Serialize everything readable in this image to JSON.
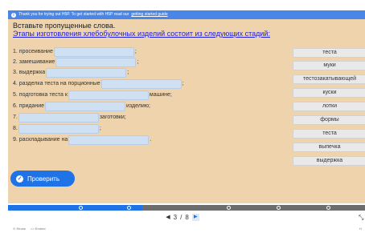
{
  "notice": {
    "text": "Thank you for trying out H5P. To get started with H5P read our",
    "link": "getting started guide"
  },
  "task": {
    "instruction": "Вставьте пропущенные слова.",
    "title": "Этапы изготовления хлебобулочных изделий состоит из следующих стадий:"
  },
  "rows": [
    {
      "before": "1. просеивание",
      "after": ";"
    },
    {
      "before": "2. замешивание",
      "after": ";"
    },
    {
      "before": "3. выдержка",
      "after": ";"
    },
    {
      "before": "4. разделка теста на порционные",
      "after": ";"
    },
    {
      "before": "5. подготовка теста к",
      "after": "машине;"
    },
    {
      "before": "6. придание",
      "after": "изделию;"
    },
    {
      "before": "7.",
      "after": "заготовки;"
    },
    {
      "before": "8.",
      "after": ";"
    },
    {
      "before": "9. раскладывание на",
      "after": "."
    }
  ],
  "words": [
    "теста",
    "муки",
    "тестозакатывающей",
    "куски",
    "лотки",
    "формы",
    "теста",
    "выпечка",
    "выдержка"
  ],
  "check_button": {
    "label": "Проверить"
  },
  "pager": {
    "current": "3",
    "separator": "/",
    "total": "8"
  },
  "footer": {
    "reuse": "Reuse",
    "embed": "<> Embed",
    "brand": "H"
  },
  "progress": {
    "fraction": 0.375
  },
  "colors": {
    "panel": "#eed3ad",
    "accent": "#1f73e6",
    "gap": "#cfe0f3"
  }
}
